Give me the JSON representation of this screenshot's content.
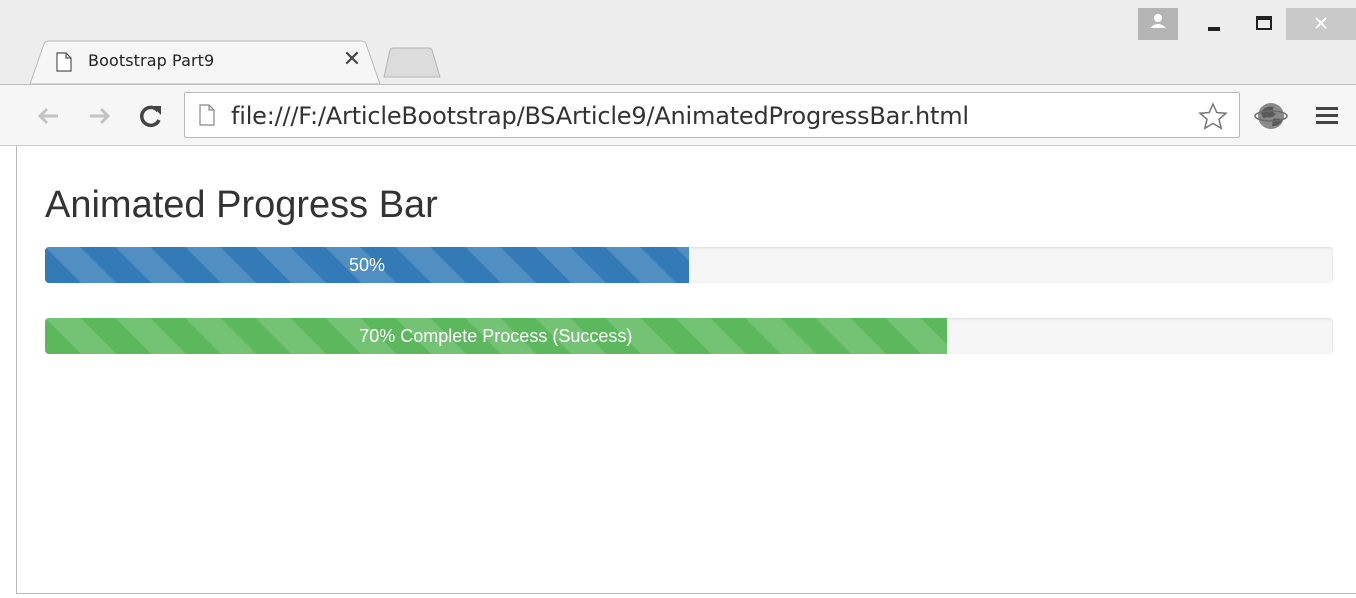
{
  "browser": {
    "tab": {
      "title": "Bootstrap Part9",
      "close_glyph": "✕",
      "icon": "page-icon"
    },
    "address_bar": {
      "url": "file:///F:/ArticleBootstrap/BSArticle9/AnimatedProgressBar.html"
    },
    "toolbar_icons": [
      "back-arrow-icon",
      "forward-arrow-icon",
      "reload-icon",
      "star-icon",
      "extension-icon",
      "menu-icon"
    ],
    "window_controls": [
      "profile-icon",
      "minimize-icon",
      "maximize-icon",
      "close-icon"
    ]
  },
  "page": {
    "title": "Animated Progress Bar",
    "progress_bars": [
      {
        "label": "50%",
        "value": 0.5,
        "color": "#337ab7"
      },
      {
        "label": "70% Complete Process (Success)",
        "value": 0.7,
        "color": "#5cb85c"
      }
    ]
  }
}
